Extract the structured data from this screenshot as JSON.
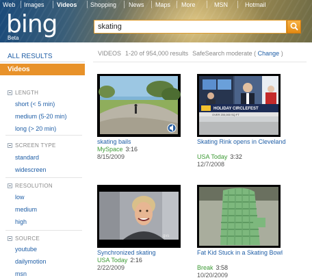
{
  "topnav": {
    "items": [
      {
        "label": "Web",
        "active": false
      },
      {
        "label": "Images",
        "active": false
      },
      {
        "label": "Videos",
        "active": true
      },
      {
        "label": "Shopping",
        "active": false
      },
      {
        "label": "News",
        "active": false
      },
      {
        "label": "Maps",
        "active": false
      },
      {
        "label": "More",
        "active": false
      },
      {
        "label": "MSN",
        "active": false
      },
      {
        "label": "Hotmail",
        "active": false
      }
    ]
  },
  "brand": {
    "logo": "bing",
    "beta": "Beta"
  },
  "search": {
    "query": "skating",
    "button_icon": "magnifier-icon"
  },
  "sidebar": {
    "all_results": "ALL RESULTS",
    "active": "Videos",
    "facets": [
      {
        "title": "LENGTH",
        "items": [
          "short (< 5 min)",
          "medium (5-20 min)",
          "long (> 20 min)"
        ]
      },
      {
        "title": "SCREEN TYPE",
        "items": [
          "standard",
          "widescreen"
        ]
      },
      {
        "title": "RESOLUTION",
        "items": [
          "low",
          "medium",
          "high"
        ]
      },
      {
        "title": "SOURCE",
        "items": [
          "youtube",
          "dailymotion",
          "msn"
        ]
      }
    ]
  },
  "results_meta": {
    "label": "VIDEOS",
    "range": "1-20 of 954,000 results",
    "safesearch": "SafeSearch moderate (",
    "change": "Change",
    "close": ")"
  },
  "results": [
    {
      "title": "skating bails",
      "source": "MySpace",
      "duration": "3:16",
      "date": "8/15/2009"
    },
    {
      "title": "Skating Rink opens in Cleveland",
      "source": "USA Today",
      "duration": "3:32",
      "date": "12/7/2008"
    },
    {
      "title": "Synchronized skating",
      "source": "USA Today",
      "duration": "2:16",
      "date": "2/22/2009"
    },
    {
      "title": "Fat Kid Stuck in a Skating Bowl",
      "source": "Break",
      "duration": "3:58",
      "date": "10/20/2009"
    }
  ],
  "thumb_text": {
    "news_ticker": "HOLIDAY CIRCLEFEST",
    "news_sub": "OVER 200,000 SQ FT",
    "watermark": "gvs"
  },
  "colors": {
    "link": "#1f5ea6",
    "source": "#3c9a34",
    "accent": "#e8922a",
    "muted": "#888888"
  }
}
